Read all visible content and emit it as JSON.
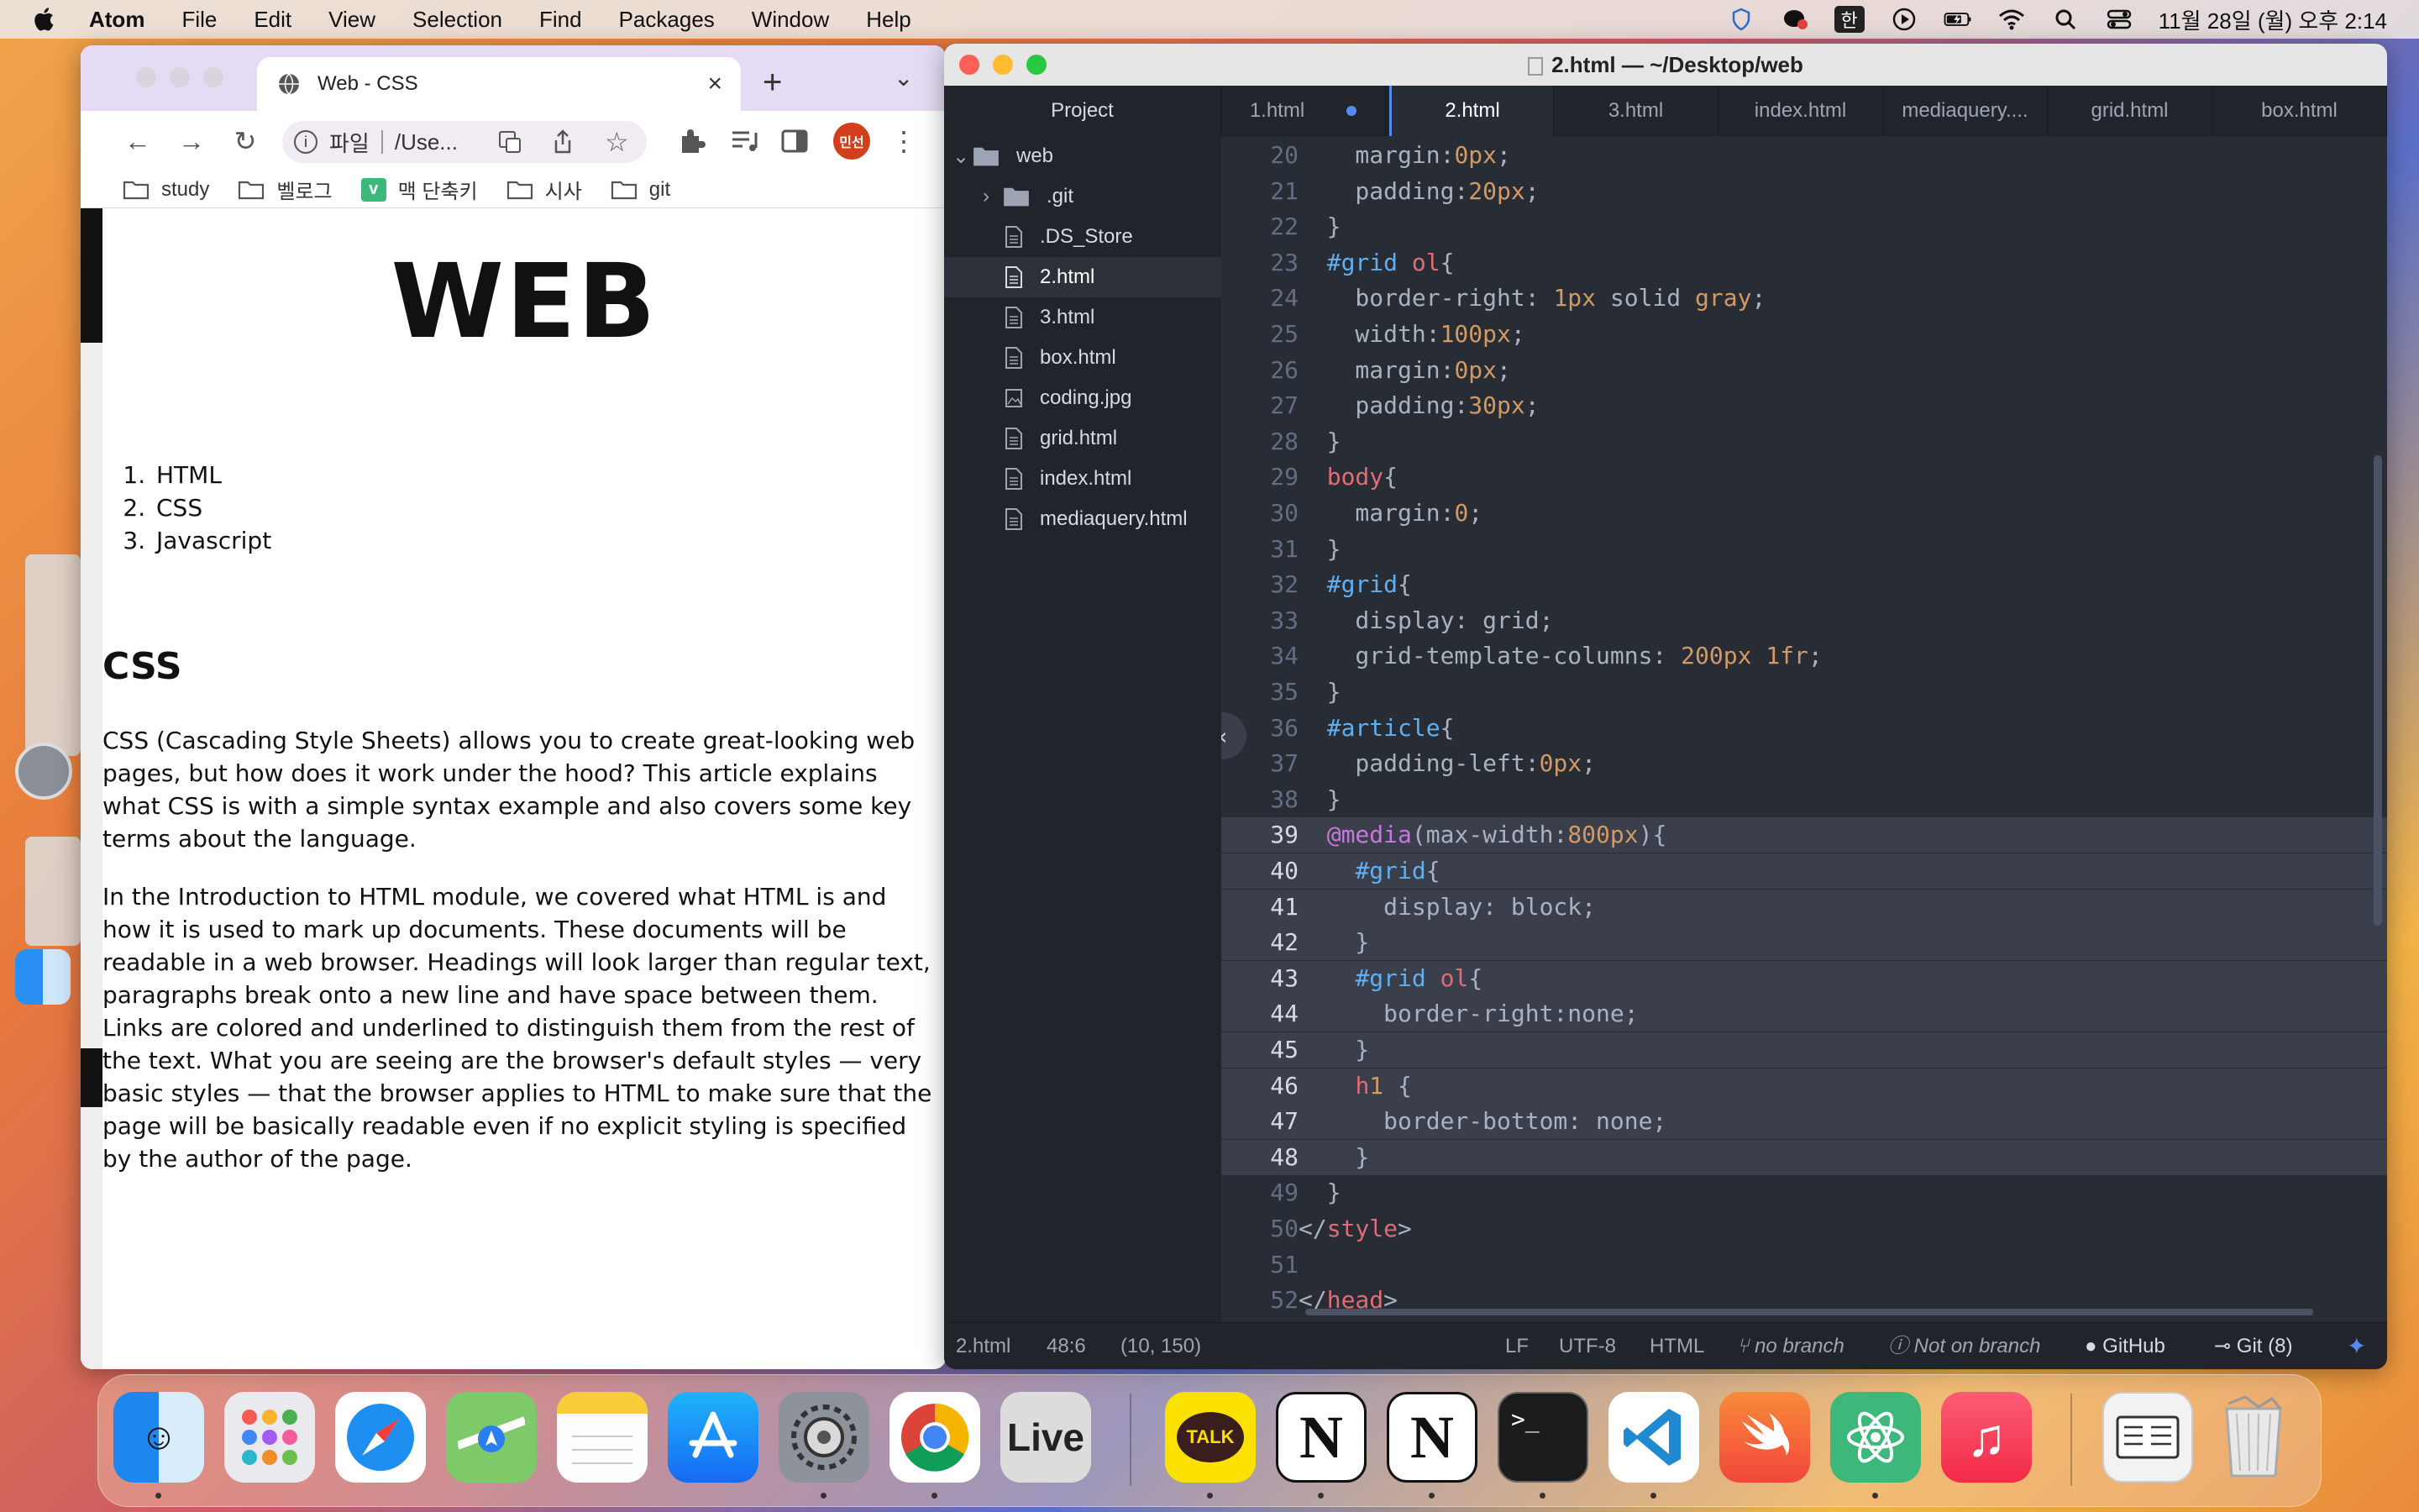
{
  "menubar": {
    "app": "Atom",
    "items": [
      "File",
      "Edit",
      "View",
      "Selection",
      "Find",
      "Packages",
      "Window",
      "Help"
    ],
    "ime": "한",
    "clock": "11월 28일 (월) 오후 2:14"
  },
  "chrome": {
    "tab_title": "Web - CSS",
    "omnibox_scheme": "파일",
    "omnibox_url": "/Use...",
    "profile": "민선",
    "bookmarks": [
      "study",
      "벨로그",
      "맥 단축키",
      "시사",
      "git"
    ],
    "page": {
      "h1": "WEB",
      "list": [
        "HTML",
        "CSS",
        "Javascript"
      ],
      "h2": "CSS",
      "p1": "CSS (Cascading Style Sheets) allows you to create great-looking web pages, but how does it work under the hood? This article explains what CSS is with a simple syntax example and also covers some key terms about the language.",
      "p2": "In the Introduction to HTML module, we covered what HTML is and how it is used to mark up documents. These documents will be readable in a web browser. Headings will look larger than regular text, paragraphs break onto a new line and have space between them. Links are colored and underlined to distinguish them from the rest of the text. What you are seeing are the browser's default styles — very basic styles — that the browser applies to HTML to make sure that the page will be basically readable even if no explicit styling is specified by the author of the page."
    }
  },
  "atom": {
    "title": "2.html — ~/Desktop/web",
    "project_label": "Project",
    "tabs": [
      "1.html",
      "2.html",
      "3.html",
      "index.html",
      "mediaquery....",
      "grid.html",
      "box.html"
    ],
    "tree": {
      "root": "web",
      "items": [
        ".git",
        ".DS_Store",
        "2.html",
        "3.html",
        "box.html",
        "coding.jpg",
        "grid.html",
        "index.html",
        "mediaquery.html"
      ]
    },
    "code_start_line": 20,
    "code_lines": [
      "    margin:0px;",
      "    padding:20px;",
      "  }",
      "  #grid ol{",
      "    border-right: 1px solid gray;",
      "    width:100px;",
      "    margin:0px;",
      "    padding:30px;",
      "  }",
      "  body{",
      "    margin:0;",
      "  }",
      "  #grid{",
      "    display: grid;",
      "    grid-template-columns: 200px 1fr;",
      "  }",
      "  #article{",
      "    padding-left:0px;",
      "  }",
      "  @media(max-width:800px){",
      "    #grid{",
      "      display: block;",
      "    }",
      "    #grid ol{",
      "      border-right:none;",
      "    }",
      "    h1 {",
      "      border-bottom: none;",
      "    }",
      "  }",
      "</style>",
      "",
      "</head>"
    ],
    "status": {
      "file": "2.html",
      "cursor": "48:6",
      "selection": "(10, 150)",
      "eol": "LF",
      "encoding": "UTF-8",
      "grammar": "HTML",
      "branch": "no branch",
      "not_on_branch": "Not on branch",
      "github": "GitHub",
      "git": "Git (8)"
    }
  },
  "dock": {
    "apps": [
      "Finder",
      "Launchpad",
      "Safari",
      "Maps",
      "Notes",
      "App Store",
      "System Preferences",
      "Chrome",
      "Live",
      "KakaoTalk",
      "Notion",
      "Notion",
      "Terminal",
      "VS Code",
      "Swift Playgrounds",
      "Atom",
      "Music",
      "Stack",
      "Trash"
    ],
    "live_label": "Live",
    "talk_label": "TALK"
  },
  "colors": {
    "atom_bg": "#282c34",
    "atom_accent": "#568af2",
    "chrome_tab_bg": "#e6dbf5"
  }
}
